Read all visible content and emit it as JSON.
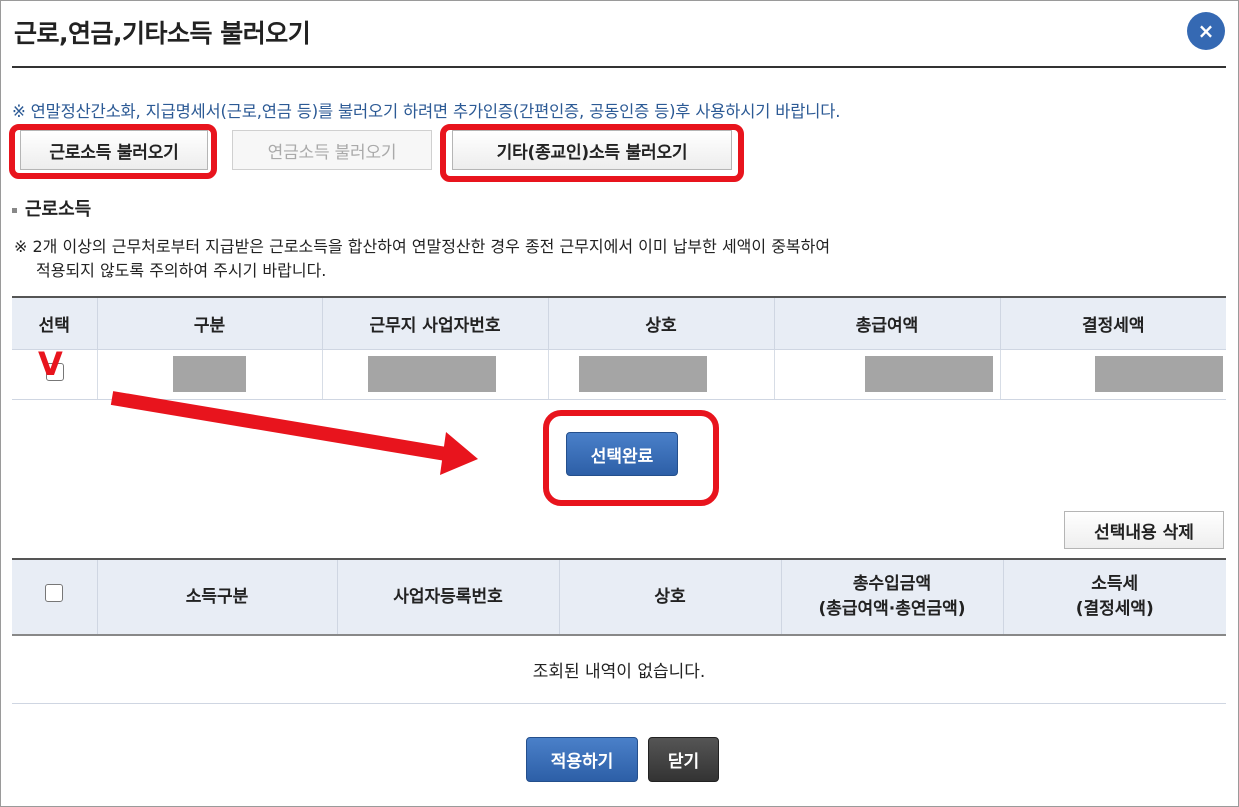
{
  "dialog": {
    "title": "근로,연금,기타소득 불러오기",
    "close_label": "×"
  },
  "notice_top": "※ 연말정산간소화, 지급명세서(근로,연금 등)를 불러오기 하려면 추가인증(간편인증, 공동인증 등)후 사용하시기 바랍니다.",
  "load_buttons": {
    "labor": "근로소득 불러오기",
    "pension": "연금소득 불러오기",
    "other": "기타(종교인)소득 불러오기"
  },
  "section": {
    "title": "근로소득",
    "notice_line1": "※ 2개 이상의 근무처로부터 지급받은 근로소득을 합산하여 연말정산한 경우 종전 근무지에서 이미 납부한 세액이 중복하여",
    "notice_line2": "적용되지 않도록 주의하여 주시기 바랍니다."
  },
  "labor_table": {
    "headers": [
      "선택",
      "구분",
      "근무지 사업자번호",
      "상호",
      "총급여액",
      "결정세액"
    ]
  },
  "annotation_mark": "V",
  "select_complete_label": "선택완료",
  "delete_selected_label": "선택내용 삭제",
  "result_table": {
    "headers": [
      "소득구분",
      "사업자등록번호",
      "상호",
      "총수입금액",
      "(총급여액·총연금액)",
      "소득세",
      "(결정세액)"
    ],
    "empty_message": "조회된 내역이 없습니다."
  },
  "footer": {
    "apply_label": "적용하기",
    "close_label": "닫기"
  },
  "colors": {
    "accent_blue": "#2d5fa7",
    "highlight_red": "#e8141d",
    "notice_blue": "#2c5a95"
  }
}
